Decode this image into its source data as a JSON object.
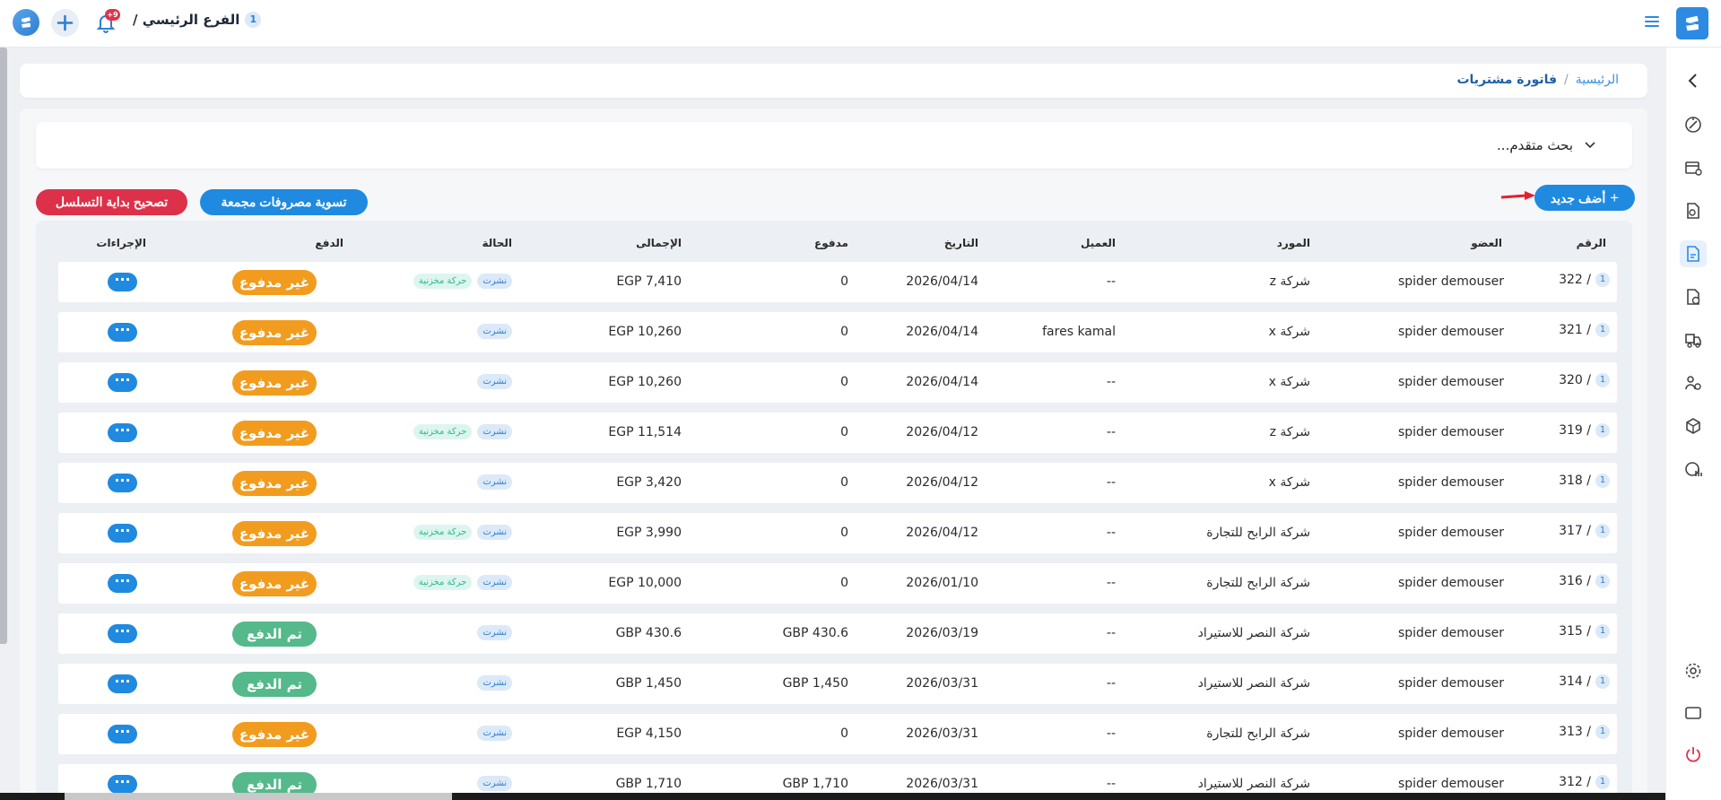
{
  "topbar": {
    "branch_name": "الفرع الرئيسي /",
    "branch_number": "1",
    "notification_count": "+9"
  },
  "breadcrumb": {
    "home": "الرئيسية",
    "separator": "/",
    "current": "فاتورة مشتريات"
  },
  "advanced_search": {
    "label": "بحث متقدم..."
  },
  "actions": {
    "add_new": "أضف جديد",
    "settle_expenses": "تسوية مصروفات مجمعة",
    "fix_sequence": "تصحيح بداية التسلسل"
  },
  "table": {
    "headers": {
      "number": "الرقم",
      "member": "العضو",
      "supplier": "المورد",
      "client": "العميل",
      "date": "التاريخ",
      "paid": "مدفوع",
      "total": "الإجمالى",
      "status": "الحالة",
      "payment": "الدفع",
      "actions": "الإجراءات"
    },
    "rows": [
      {
        "branch": "1",
        "number": "322 /",
        "member": "spider demouser",
        "supplier": "شركة z",
        "client": "--",
        "date": "2026/04/14",
        "paid": "0",
        "total": "EGP 7,410",
        "status": "نشرت",
        "stock": "حركة مخزنية",
        "payment": "غير مدفوع",
        "paid_state": "unpaid",
        "actions": "···"
      },
      {
        "branch": "1",
        "number": "321 /",
        "member": "spider demouser",
        "supplier": "شركة x",
        "client": "fares kamal",
        "date": "2026/04/14",
        "paid": "0",
        "total": "EGP 10,260",
        "status": "نشرت",
        "stock": "",
        "payment": "غير مدفوع",
        "paid_state": "unpaid",
        "actions": "···"
      },
      {
        "branch": "1",
        "number": "320 /",
        "member": "spider demouser",
        "supplier": "شركة x",
        "client": "--",
        "date": "2026/04/14",
        "paid": "0",
        "total": "EGP 10,260",
        "status": "نشرت",
        "stock": "",
        "payment": "غير مدفوع",
        "paid_state": "unpaid",
        "actions": "···"
      },
      {
        "branch": "1",
        "number": "319 /",
        "member": "spider demouser",
        "supplier": "شركة z",
        "client": "--",
        "date": "2026/04/12",
        "paid": "0",
        "total": "EGP 11,514",
        "status": "نشرت",
        "stock": "حركة مخزنية",
        "payment": "غير مدفوع",
        "paid_state": "unpaid",
        "actions": "···"
      },
      {
        "branch": "1",
        "number": "318 /",
        "member": "spider demouser",
        "supplier": "شركة x",
        "client": "--",
        "date": "2026/04/12",
        "paid": "0",
        "total": "EGP 3,420",
        "status": "نشرت",
        "stock": "",
        "payment": "غير مدفوع",
        "paid_state": "unpaid",
        "actions": "···"
      },
      {
        "branch": "1",
        "number": "317 /",
        "member": "spider demouser",
        "supplier": "شركة الرابح للتجارة",
        "client": "--",
        "date": "2026/04/12",
        "paid": "0",
        "total": "EGP 3,990",
        "status": "نشرت",
        "stock": "حركة مخزنية",
        "payment": "غير مدفوع",
        "paid_state": "unpaid",
        "actions": "···"
      },
      {
        "branch": "1",
        "number": "316 /",
        "member": "spider demouser",
        "supplier": "شركة الرابح للتجارة",
        "client": "--",
        "date": "2026/01/10",
        "paid": "0",
        "total": "EGP 10,000",
        "status": "نشرت",
        "stock": "حركة مخزنية",
        "payment": "غير مدفوع",
        "paid_state": "unpaid",
        "actions": "···"
      },
      {
        "branch": "1",
        "number": "315 /",
        "member": "spider demouser",
        "supplier": "شركة النصر للاستيراد",
        "client": "--",
        "date": "2026/03/19",
        "paid": "GBP 430.6",
        "total": "GBP 430.6",
        "status": "نشرت",
        "stock": "",
        "payment": "تم الدفع",
        "paid_state": "paid",
        "actions": "···"
      },
      {
        "branch": "1",
        "number": "314 /",
        "member": "spider demouser",
        "supplier": "شركة النصر للاستيراد",
        "client": "--",
        "date": "2026/03/31",
        "paid": "GBP 1,450",
        "total": "GBP 1,450",
        "status": "نشرت",
        "stock": "",
        "payment": "تم الدفع",
        "paid_state": "paid",
        "actions": "···"
      },
      {
        "branch": "1",
        "number": "313 /",
        "member": "spider demouser",
        "supplier": "شركة الرابح للتجارة",
        "client": "--",
        "date": "2026/03/31",
        "paid": "0",
        "total": "EGP 4,150",
        "status": "نشرت",
        "stock": "",
        "payment": "غير مدفوع",
        "paid_state": "unpaid",
        "actions": "···"
      },
      {
        "branch": "1",
        "number": "312 /",
        "member": "spider demouser",
        "supplier": "شركة النصر للاستيراد",
        "client": "--",
        "date": "2026/03/31",
        "paid": "GBP 1,710",
        "total": "GBP 1,710",
        "status": "نشرت",
        "stock": "",
        "payment": "تم الدفع",
        "paid_state": "paid",
        "actions": "···"
      }
    ]
  },
  "sidebar_icons": [
    "collapse-chevron-icon",
    "dashboard-icon",
    "cash-register-icon",
    "document-search-icon",
    "purchase-invoice-icon",
    "sales-invoice-icon",
    "inventory-icon",
    "users-icon",
    "products-icon",
    "reports-icon",
    "settings-icon",
    "screen-icon",
    "power-icon"
  ],
  "colors": {
    "primary": "#1f8ae0",
    "danger": "#dd3049",
    "unpaid": "#f29c1f",
    "paid": "#55b98b",
    "logout": "#e0334c"
  }
}
